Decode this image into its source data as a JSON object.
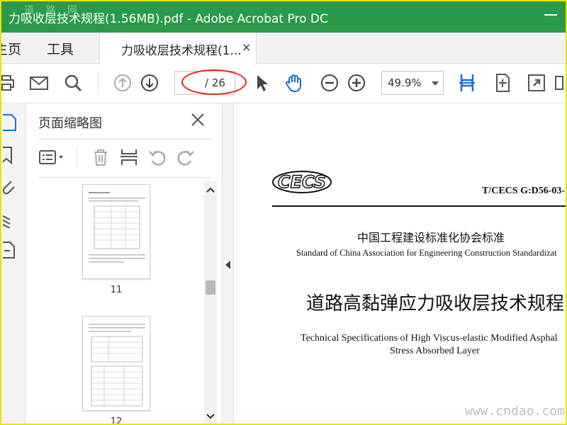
{
  "window": {
    "title": "力吸收层技术规程(1.56MB).pdf - Adobe Acrobat Pro DC",
    "watermark": "道 路 网"
  },
  "menu": {
    "home": "主页",
    "tools": "工具"
  },
  "tab": {
    "label": "力吸收层技术规程(1...",
    "close": "×"
  },
  "toolbar": {
    "page_current": "",
    "page_total": "/ 26",
    "zoom": "49.9%"
  },
  "thumbnails_panel": {
    "title": "页面缩略图",
    "pages": [
      {
        "number": "11"
      },
      {
        "number": "12"
      }
    ]
  },
  "document": {
    "logo_text": "CECS",
    "standard_code": "T/CECS G:D56-03-",
    "org_cn": "中国工程建设标准化协会标准",
    "org_en": "Standard of China Association for Engineering Construction Standardizat",
    "title_cn": "道路高黏弹应力吸收层技术规程",
    "title_en_line1": "Technical Specifications of  High Viscus-elastic Modified Asphal",
    "title_en_line2": "Stress Absorbed Layer"
  },
  "site_watermark": "www.cndao.com",
  "colors": {
    "titlebar": "#2a9a4a",
    "accent_blue": "#1a6fd1",
    "frame": "#e9e400",
    "highlight_oval": "#e0261d"
  }
}
